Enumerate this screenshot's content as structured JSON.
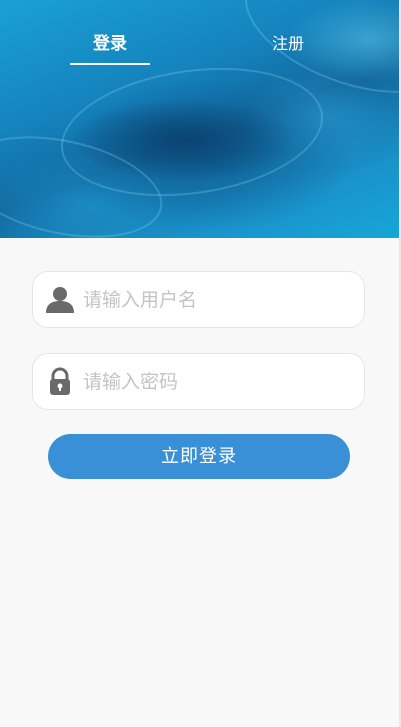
{
  "tabs": {
    "login_label": "登录",
    "register_label": "注册",
    "active": "login"
  },
  "form": {
    "username_placeholder": "请输入用户名",
    "username_value": "",
    "password_placeholder": "请输入密码",
    "password_value": "",
    "submit_label": "立即登录"
  },
  "icons": {
    "username": "user-icon",
    "password": "lock-icon"
  },
  "colors": {
    "header_background": "#1583bd",
    "button": "#3a90d6",
    "page_background": "#f8f8f8",
    "icon": "#6a6a6a",
    "placeholder": "#c4c4c4"
  }
}
